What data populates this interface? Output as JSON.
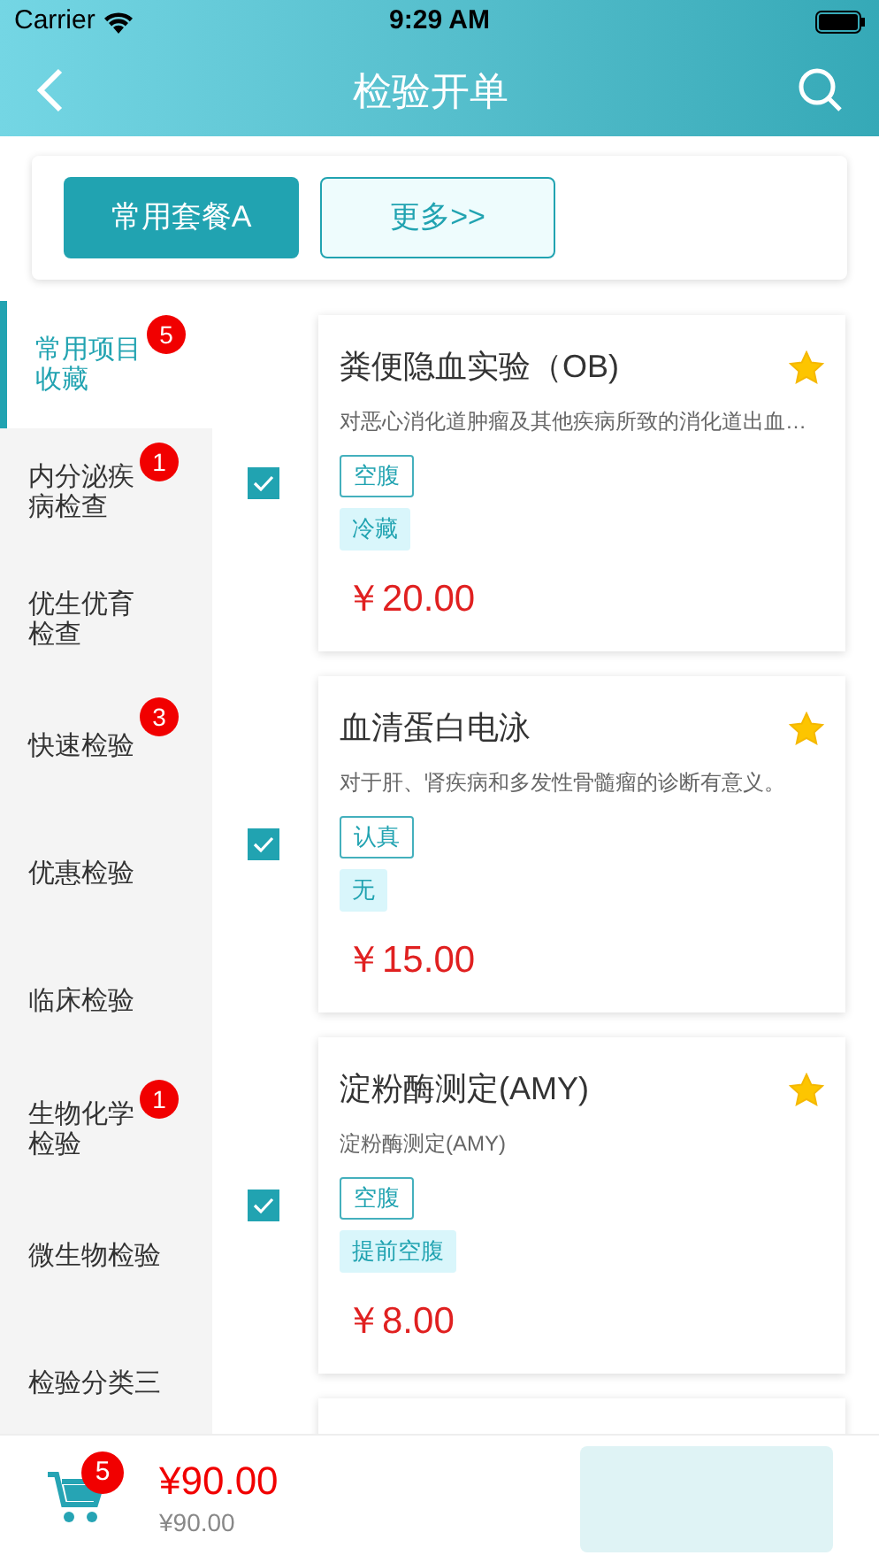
{
  "status_bar": {
    "carrier": "Carrier",
    "time": "9:29 AM"
  },
  "nav": {
    "title": "检验开单"
  },
  "packages": [
    {
      "label": "常用套餐A",
      "selected": true
    },
    {
      "label": "更多>>",
      "selected": false
    }
  ],
  "sidebar": {
    "items": [
      {
        "label": "常用项目收藏",
        "selected": true,
        "badge": "5"
      },
      {
        "label": "内分泌疾病检查",
        "selected": false,
        "badge": "1"
      },
      {
        "label": "优生优育检查",
        "selected": false
      },
      {
        "label": "快速检验",
        "selected": false,
        "badge": "3"
      },
      {
        "label": "优惠检验",
        "selected": false
      },
      {
        "label": "临床检验",
        "selected": false
      },
      {
        "label": "生物化学检验",
        "selected": false,
        "badge": "1"
      },
      {
        "label": "微生物检验",
        "selected": false
      },
      {
        "label": "检验分类三",
        "selected": false
      }
    ]
  },
  "tests": [
    {
      "name": "粪便隐血实验（OB)",
      "description": "对恶心消化道肿瘤及其他疾病所致的消化道出血…",
      "starred": true,
      "checked": true,
      "tags": [
        {
          "label": "空腹",
          "kind": "outline"
        },
        {
          "label": "冷藏",
          "kind": "filled"
        }
      ],
      "price": "￥20.00"
    },
    {
      "name": "血清蛋白电泳",
      "description": "对于肝、肾疾病和多发性骨髓瘤的诊断有意义。",
      "starred": true,
      "checked": true,
      "tags": [
        {
          "label": "认真",
          "kind": "outline"
        },
        {
          "label": "无",
          "kind": "filled"
        }
      ],
      "price": "￥15.00"
    },
    {
      "name": "淀粉酶测定(AMY)",
      "description": "淀粉酶测定(AMY)",
      "starred": true,
      "checked": true,
      "tags": [
        {
          "label": "空腹",
          "kind": "outline"
        },
        {
          "label": "提前空腹",
          "kind": "filled"
        }
      ],
      "price": "￥8.00"
    }
  ],
  "cart": {
    "badge": "5",
    "total": "¥90.00",
    "original_total": "¥90.00"
  }
}
